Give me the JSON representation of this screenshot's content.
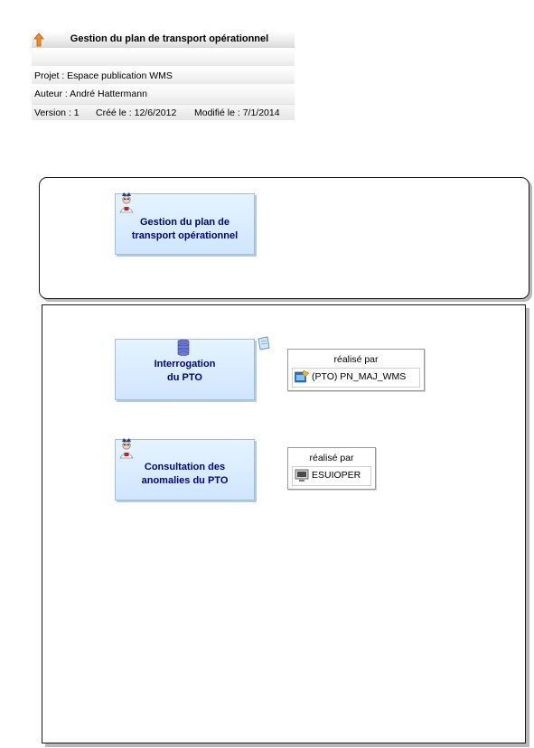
{
  "header": {
    "title": "Gestion du plan de transport opérationnel",
    "projet": "Projet : Espace publication WMS",
    "auteur": "Auteur : André Hattermann",
    "version": "Version : 1",
    "cree": "Créé le : 12/6/2012",
    "modifie": "Modifié le : 7/1/2014"
  },
  "diagram": {
    "top_process": {
      "label_line1": "Gestion du plan de",
      "label_line2": "transport opérationnel"
    },
    "processes": [
      {
        "label_line1": "Interrogation",
        "label_line2": "du PTO",
        "icon": "database-icon"
      },
      {
        "label_line1": "Consultation des",
        "label_line2": "anomalies du PTO",
        "icon": "person-icon"
      }
    ],
    "realise_par": [
      {
        "title": "réalisé par",
        "item": "(PTO) PN_MAJ_WMS",
        "icon": "application-icon"
      },
      {
        "title": "réalisé par",
        "item": "ESUIOPER",
        "icon": "screen-icon"
      }
    ]
  },
  "colors": {
    "process_fill": "#d6ebff",
    "process_text": "#00008b",
    "header_arrow": "#f08c1e"
  }
}
